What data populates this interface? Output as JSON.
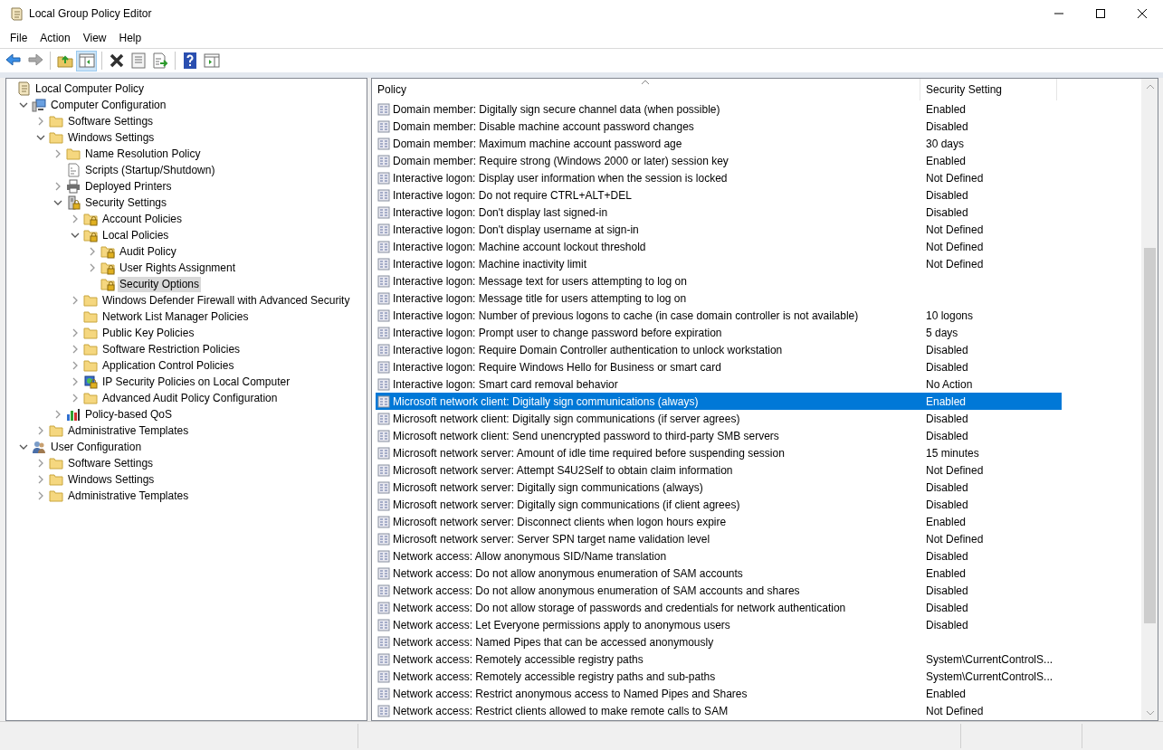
{
  "window": {
    "title": "Local Group Policy Editor"
  },
  "menu": [
    "File",
    "Action",
    "View",
    "Help"
  ],
  "toolbar": [
    {
      "kind": "back",
      "disabled": false,
      "pressed": false
    },
    {
      "kind": "forward",
      "disabled": true,
      "pressed": false
    },
    {
      "kind": "sep"
    },
    {
      "kind": "up",
      "disabled": false,
      "pressed": false
    },
    {
      "kind": "tree",
      "disabled": false,
      "pressed": true
    },
    {
      "kind": "sep"
    },
    {
      "kind": "delete",
      "disabled": false,
      "pressed": false
    },
    {
      "kind": "properties",
      "disabled": false,
      "pressed": false
    },
    {
      "kind": "export",
      "disabled": false,
      "pressed": false
    },
    {
      "kind": "sep"
    },
    {
      "kind": "help",
      "disabled": false,
      "pressed": false
    },
    {
      "kind": "action",
      "disabled": false,
      "pressed": false
    }
  ],
  "tree": [
    {
      "label": "Local Computer Policy",
      "kind": "scroll",
      "selected": false,
      "children": [
        {
          "label": "Computer Configuration",
          "kind": "computer",
          "expanded": true,
          "selected": false,
          "children": [
            {
              "label": "Software Settings",
              "kind": "folder",
              "expanded": false,
              "selected": false
            },
            {
              "label": "Windows Settings",
              "kind": "folder",
              "expanded": true,
              "selected": false,
              "children": [
                {
                  "label": "Name Resolution Policy",
                  "kind": "folder",
                  "expanded": false,
                  "selected": false
                },
                {
                  "label": "Scripts (Startup/Shutdown)",
                  "kind": "script",
                  "selected": false
                },
                {
                  "label": "Deployed Printers",
                  "kind": "printer",
                  "expanded": false,
                  "selected": false
                },
                {
                  "label": "Security Settings",
                  "kind": "server",
                  "expanded": true,
                  "selected": false,
                  "children": [
                    {
                      "label": "Account Policies",
                      "kind": "lockfolder",
                      "expanded": false,
                      "selected": false
                    },
                    {
                      "label": "Local Policies",
                      "kind": "lockfolder",
                      "expanded": true,
                      "selected": false,
                      "children": [
                        {
                          "label": "Audit Policy",
                          "kind": "lockfolder",
                          "expanded": false,
                          "selected": false
                        },
                        {
                          "label": "User Rights Assignment",
                          "kind": "lockfolder",
                          "expanded": false,
                          "selected": false
                        },
                        {
                          "label": "Security Options",
                          "kind": "lockfolder",
                          "selected": true
                        }
                      ]
                    },
                    {
                      "label": "Windows Defender Firewall with Advanced Security",
                      "kind": "folder",
                      "expanded": false,
                      "selected": false
                    },
                    {
                      "label": "Network List Manager Policies",
                      "kind": "folder",
                      "selected": false
                    },
                    {
                      "label": "Public Key Policies",
                      "kind": "folder",
                      "expanded": false,
                      "selected": false
                    },
                    {
                      "label": "Software Restriction Policies",
                      "kind": "folder",
                      "expanded": false,
                      "selected": false
                    },
                    {
                      "label": "Application Control Policies",
                      "kind": "folder",
                      "expanded": false,
                      "selected": false
                    },
                    {
                      "label": "IP Security Policies on Local Computer",
                      "kind": "ipsec",
                      "expanded": false,
                      "selected": false
                    },
                    {
                      "label": "Advanced Audit Policy Configuration",
                      "kind": "folder",
                      "expanded": false,
                      "selected": false
                    }
                  ]
                },
                {
                  "label": "Policy-based QoS",
                  "kind": "chart",
                  "expanded": false,
                  "selected": false
                }
              ]
            },
            {
              "label": "Administrative Templates",
              "kind": "folder",
              "expanded": false,
              "selected": false
            }
          ]
        },
        {
          "label": "User Configuration",
          "kind": "user",
          "expanded": true,
          "selected": false,
          "children": [
            {
              "label": "Software Settings",
              "kind": "folder",
              "expanded": false,
              "selected": false
            },
            {
              "label": "Windows Settings",
              "kind": "folder",
              "expanded": false,
              "selected": false
            },
            {
              "label": "Administrative Templates",
              "kind": "folder",
              "expanded": false,
              "selected": false
            }
          ]
        }
      ]
    }
  ],
  "table": {
    "columns": [
      "Policy",
      "Security Setting"
    ],
    "rows": [
      {
        "policy": "Domain member: Digitally sign secure channel data (when possible)",
        "setting": "Enabled",
        "selected": false
      },
      {
        "policy": "Domain member: Disable machine account password changes",
        "setting": "Disabled",
        "selected": false
      },
      {
        "policy": "Domain member: Maximum machine account password age",
        "setting": "30 days",
        "selected": false
      },
      {
        "policy": "Domain member: Require strong (Windows 2000 or later) session key",
        "setting": "Enabled",
        "selected": false
      },
      {
        "policy": "Interactive logon: Display user information when the session is locked",
        "setting": "Not Defined",
        "selected": false
      },
      {
        "policy": "Interactive logon: Do not require CTRL+ALT+DEL",
        "setting": "Disabled",
        "selected": false
      },
      {
        "policy": "Interactive logon: Don't display last signed-in",
        "setting": "Disabled",
        "selected": false
      },
      {
        "policy": "Interactive logon: Don't display username at sign-in",
        "setting": "Not Defined",
        "selected": false
      },
      {
        "policy": "Interactive logon: Machine account lockout threshold",
        "setting": "Not Defined",
        "selected": false
      },
      {
        "policy": "Interactive logon: Machine inactivity limit",
        "setting": "Not Defined",
        "selected": false
      },
      {
        "policy": "Interactive logon: Message text for users attempting to log on",
        "selected": false
      },
      {
        "policy": "Interactive logon: Message title for users attempting to log on",
        "selected": false
      },
      {
        "policy": "Interactive logon: Number of previous logons to cache (in case domain controller is not available)",
        "setting": "10 logons",
        "selected": false
      },
      {
        "policy": "Interactive logon: Prompt user to change password before expiration",
        "setting": "5 days",
        "selected": false
      },
      {
        "policy": "Interactive logon: Require Domain Controller authentication to unlock workstation",
        "setting": "Disabled",
        "selected": false
      },
      {
        "policy": "Interactive logon: Require Windows Hello for Business or smart card",
        "setting": "Disabled",
        "selected": false
      },
      {
        "policy": "Interactive logon: Smart card removal behavior",
        "setting": "No Action",
        "selected": false
      },
      {
        "policy": "Microsoft network client: Digitally sign communications (always)",
        "setting": "Enabled",
        "selected": true
      },
      {
        "policy": "Microsoft network client: Digitally sign communications (if server agrees)",
        "setting": "Disabled",
        "selected": false
      },
      {
        "policy": "Microsoft network client: Send unencrypted password to third-party SMB servers",
        "setting": "Disabled",
        "selected": false
      },
      {
        "policy": "Microsoft network server: Amount of idle time required before suspending session",
        "setting": "15 minutes",
        "selected": false
      },
      {
        "policy": "Microsoft network server: Attempt S4U2Self to obtain claim information",
        "setting": "Not Defined",
        "selected": false
      },
      {
        "policy": "Microsoft network server: Digitally sign communications (always)",
        "setting": "Disabled",
        "selected": false
      },
      {
        "policy": "Microsoft network server: Digitally sign communications (if client agrees)",
        "setting": "Disabled",
        "selected": false
      },
      {
        "policy": "Microsoft network server: Disconnect clients when logon hours expire",
        "setting": "Enabled",
        "selected": false
      },
      {
        "policy": "Microsoft network server: Server SPN target name validation level",
        "setting": "Not Defined",
        "selected": false
      },
      {
        "policy": "Network access: Allow anonymous SID/Name translation",
        "setting": "Disabled",
        "selected": false
      },
      {
        "policy": "Network access: Do not allow anonymous enumeration of SAM accounts",
        "setting": "Enabled",
        "selected": false
      },
      {
        "policy": "Network access: Do not allow anonymous enumeration of SAM accounts and shares",
        "setting": "Disabled",
        "selected": false
      },
      {
        "policy": "Network access: Do not allow storage of passwords and credentials for network authentication",
        "setting": "Disabled",
        "selected": false
      },
      {
        "policy": "Network access: Let Everyone permissions apply to anonymous users",
        "setting": "Disabled",
        "selected": false
      },
      {
        "policy": "Network access: Named Pipes that can be accessed anonymously",
        "selected": false
      },
      {
        "policy": "Network access: Remotely accessible registry paths",
        "setting": "System\\CurrentControlS...",
        "selected": false
      },
      {
        "policy": "Network access: Remotely accessible registry paths and sub-paths",
        "setting": "System\\CurrentControlS...",
        "selected": false
      },
      {
        "policy": "Network access: Restrict anonymous access to Named Pipes and Shares",
        "setting": "Enabled",
        "selected": false
      },
      {
        "policy": "Network access: Restrict clients allowed to make remote calls to SAM",
        "setting": "Not Defined",
        "selected": false
      }
    ]
  }
}
